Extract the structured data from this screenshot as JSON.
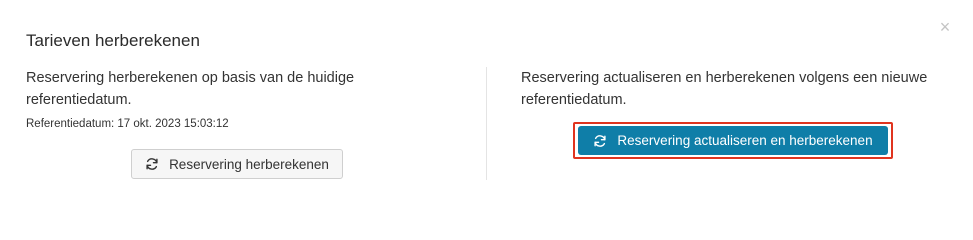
{
  "dialog": {
    "title": "Tarieven herberekenen",
    "close_icon": "close-icon"
  },
  "left": {
    "description": "Reservering herberekenen op basis van de huidige referentiedatum.",
    "reference_date": "Referentiedatum: 17 okt. 2023 15:03:12",
    "button_label": "Reservering herberekenen",
    "button_icon": "refresh-icon"
  },
  "right": {
    "description": "Reservering actualiseren en herberekenen volgens een nieuwe referentiedatum.",
    "button_label": "Reservering actualiseren en herberekenen",
    "button_icon": "refresh-icon"
  },
  "colors": {
    "primary": "#0f7ea8",
    "highlight": "#e0341f",
    "secondary_bg": "#f6f6f6"
  }
}
